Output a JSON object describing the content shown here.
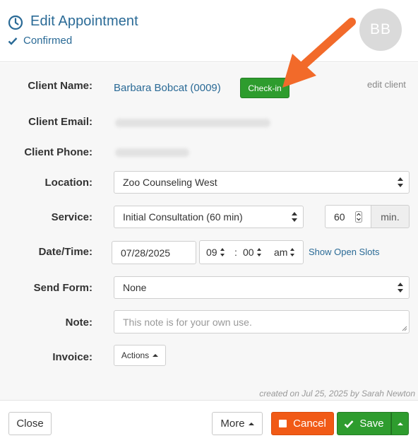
{
  "header": {
    "title": "Edit Appointment",
    "status": "Confirmed",
    "avatar_initials": "BB"
  },
  "form": {
    "client_name": {
      "label": "Client Name:",
      "value": "Barbara Bobcat (0009)",
      "checkin_label": "Check-in",
      "edit_link": "edit client"
    },
    "client_email": {
      "label": "Client Email:"
    },
    "client_phone": {
      "label": "Client Phone:"
    },
    "location": {
      "label": "Location:",
      "value": "Zoo Counseling West"
    },
    "service": {
      "label": "Service:",
      "value": "Initial Consultation (60 min)",
      "duration": "60",
      "unit": "min."
    },
    "datetime": {
      "label": "Date/Time:",
      "date": "07/28/2025",
      "hour": "09",
      "separator": ":",
      "minute": "00",
      "ampm": "am",
      "slots_link": "Show Open Slots"
    },
    "send_form": {
      "label": "Send Form:",
      "value": "None"
    },
    "note": {
      "label": "Note:",
      "placeholder": "This note is for your own use."
    },
    "invoice": {
      "label": "Invoice:",
      "actions_label": "Actions"
    }
  },
  "created_text": "created on Jul 25, 2025 by Sarah Newton",
  "footer": {
    "close_label": "Close",
    "more_label": "More",
    "cancel_label": "Cancel",
    "save_label": "Save"
  },
  "colors": {
    "accent_blue": "#2a6a96",
    "green": "#2e9c2e",
    "orange": "#f15a16",
    "arrow": "#f26a2a"
  },
  "icons": [
    "clock-icon",
    "check-icon",
    "updown-icon",
    "caret-up-icon",
    "square-icon",
    "arrow-annotation"
  ]
}
